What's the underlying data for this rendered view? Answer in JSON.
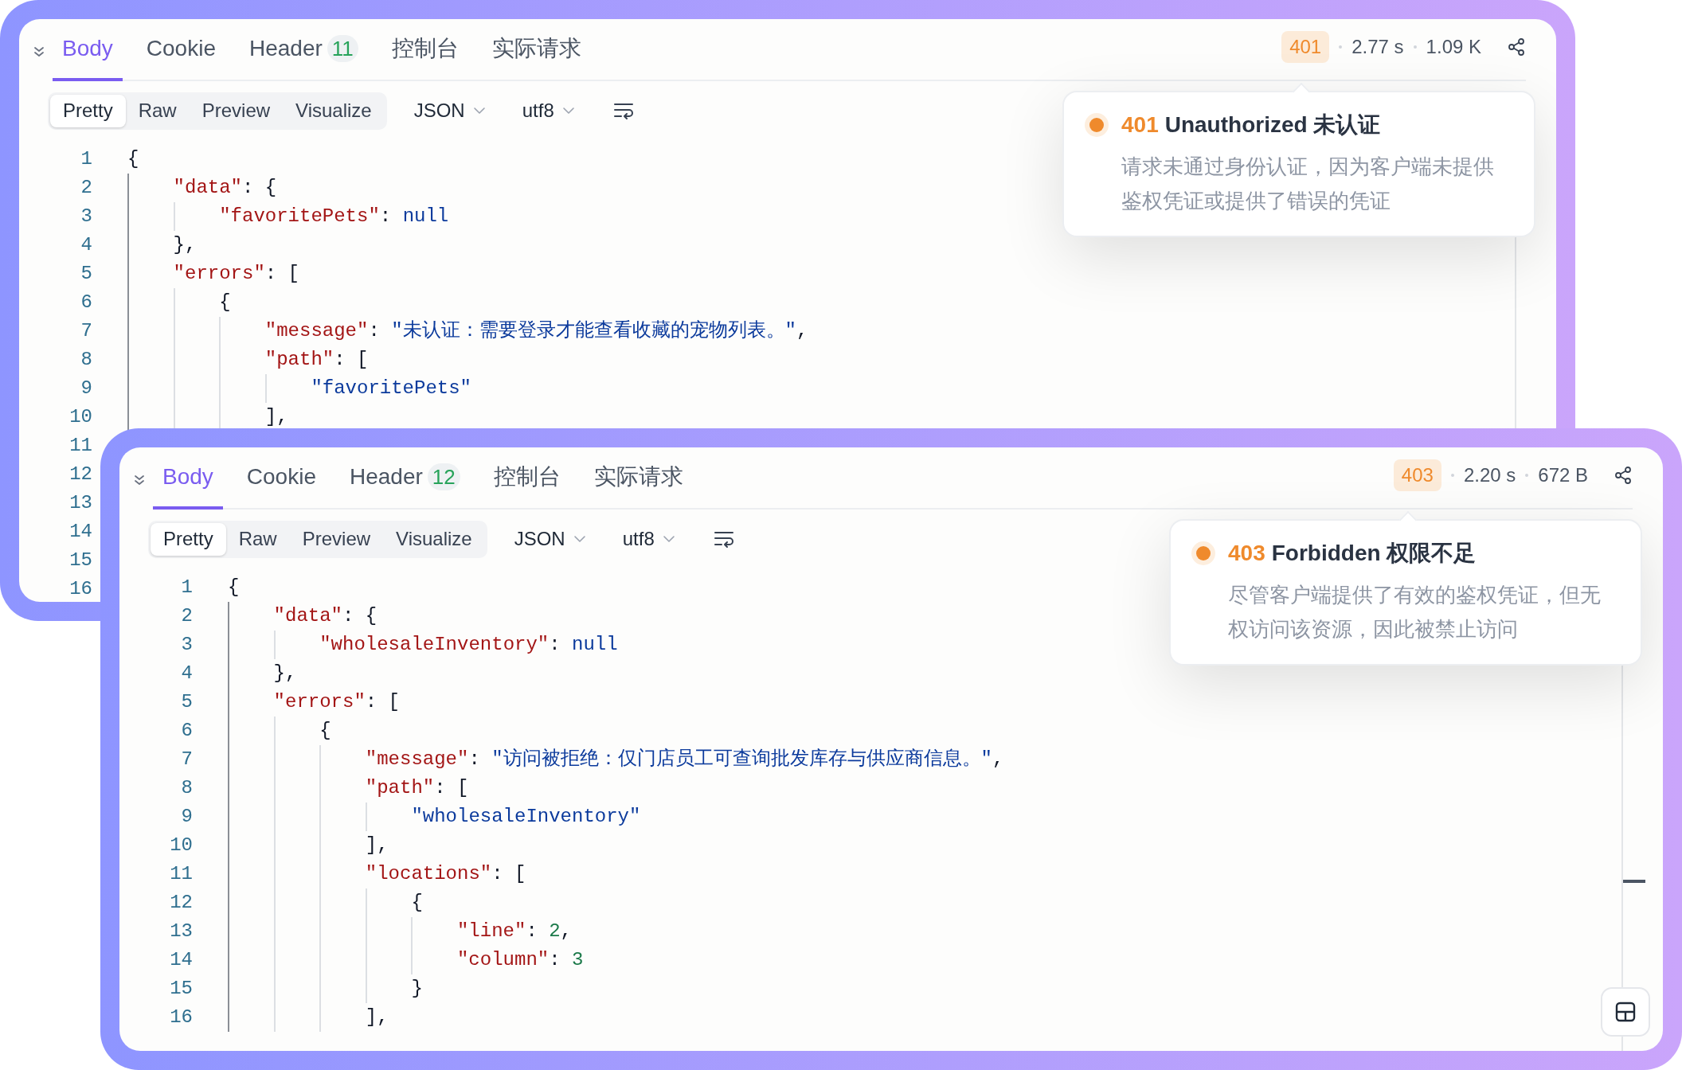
{
  "panels": [
    {
      "tabs": [
        {
          "label": "Body",
          "selected": true
        },
        {
          "label": "Cookie",
          "selected": false
        },
        {
          "label": "Header",
          "count": "11",
          "selected": false
        },
        {
          "label": "控制台",
          "selected": false
        },
        {
          "label": "实际请求",
          "selected": false
        }
      ],
      "status": {
        "code": "401",
        "time": "2.77 s",
        "size": "1.09 K"
      },
      "view_modes": [
        {
          "label": "Pretty",
          "selected": true
        },
        {
          "label": "Raw",
          "selected": false
        },
        {
          "label": "Preview",
          "selected": false
        },
        {
          "label": "Visualize",
          "selected": false
        }
      ],
      "format": "JSON",
      "encoding": "utf8",
      "lines": [
        {
          "num": "1",
          "tokens": [
            {
              "kind": "punct",
              "text": "{"
            }
          ],
          "children": [
            {
              "num": "2",
              "tokens": [
                {
                  "kind": "key",
                  "text": "\"data\""
                },
                {
                  "kind": "punct",
                  "text": ": {"
                }
              ],
              "children": [
                {
                  "num": "3",
                  "tokens": [
                    {
                      "kind": "key",
                      "text": "\"favoritePets\""
                    },
                    {
                      "kind": "punct",
                      "text": ": "
                    },
                    {
                      "kind": "literal",
                      "text": "null"
                    }
                  ]
                }
              ]
            },
            {
              "num": "4",
              "tokens": [
                {
                  "kind": "punct",
                  "text": "},"
                }
              ]
            },
            {
              "num": "5",
              "tokens": [
                {
                  "kind": "key",
                  "text": "\"errors\""
                },
                {
                  "kind": "punct",
                  "text": ": ["
                }
              ],
              "children": [
                {
                  "num": "6",
                  "tokens": [
                    {
                      "kind": "punct",
                      "text": "{"
                    }
                  ],
                  "children": [
                    {
                      "num": "7",
                      "tokens": [
                        {
                          "kind": "key",
                          "text": "\"message\""
                        },
                        {
                          "kind": "punct",
                          "text": ": "
                        },
                        {
                          "kind": "string",
                          "text": "\"未认证：需要登录才能查看收藏的宠物列表。\""
                        },
                        {
                          "kind": "punct",
                          "text": ","
                        }
                      ]
                    },
                    {
                      "num": "8",
                      "tokens": [
                        {
                          "kind": "key",
                          "text": "\"path\""
                        },
                        {
                          "kind": "punct",
                          "text": ": ["
                        }
                      ],
                      "children": [
                        {
                          "num": "9",
                          "tokens": [
                            {
                              "kind": "string",
                              "text": "\"favoritePets\""
                            }
                          ]
                        }
                      ]
                    },
                    {
                      "num": "10",
                      "tokens": [
                        {
                          "kind": "punct",
                          "text": "],"
                        }
                      ]
                    }
                  ]
                }
              ]
            }
          ]
        },
        {
          "num": "11"
        },
        {
          "num": "12"
        },
        {
          "num": "13"
        },
        {
          "num": "14"
        },
        {
          "num": "15"
        },
        {
          "num": "16"
        }
      ],
      "tooltip": {
        "code": "401",
        "title": "Unauthorized 未认证",
        "description": "请求未通过身份认证，因为客户端未提供鉴权凭证或提供了错误的凭证",
        "color": "#ef8a2c"
      }
    },
    {
      "tabs": [
        {
          "label": "Body",
          "selected": true
        },
        {
          "label": "Cookie",
          "selected": false
        },
        {
          "label": "Header",
          "count": "12",
          "selected": false
        },
        {
          "label": "控制台",
          "selected": false
        },
        {
          "label": "实际请求",
          "selected": false
        }
      ],
      "status": {
        "code": "403",
        "time": "2.20 s",
        "size": "672 B"
      },
      "view_modes": [
        {
          "label": "Pretty",
          "selected": true
        },
        {
          "label": "Raw",
          "selected": false
        },
        {
          "label": "Preview",
          "selected": false
        },
        {
          "label": "Visualize",
          "selected": false
        }
      ],
      "format": "JSON",
      "encoding": "utf8",
      "lines": [
        {
          "num": "1",
          "tokens": [
            {
              "kind": "punct",
              "text": "{"
            }
          ],
          "children": [
            {
              "num": "2",
              "tokens": [
                {
                  "kind": "key",
                  "text": "\"data\""
                },
                {
                  "kind": "punct",
                  "text": ": {"
                }
              ],
              "children": [
                {
                  "num": "3",
                  "tokens": [
                    {
                      "kind": "key",
                      "text": "\"wholesaleInventory\""
                    },
                    {
                      "kind": "punct",
                      "text": ": "
                    },
                    {
                      "kind": "literal",
                      "text": "null"
                    }
                  ]
                }
              ]
            },
            {
              "num": "4",
              "tokens": [
                {
                  "kind": "punct",
                  "text": "},"
                }
              ]
            },
            {
              "num": "5",
              "tokens": [
                {
                  "kind": "key",
                  "text": "\"errors\""
                },
                {
                  "kind": "punct",
                  "text": ": ["
                }
              ],
              "children": [
                {
                  "num": "6",
                  "tokens": [
                    {
                      "kind": "punct",
                      "text": "{"
                    }
                  ],
                  "children": [
                    {
                      "num": "7",
                      "tokens": [
                        {
                          "kind": "key",
                          "text": "\"message\""
                        },
                        {
                          "kind": "punct",
                          "text": ": "
                        },
                        {
                          "kind": "string",
                          "text": "\"访问被拒绝：仅门店员工可查询批发库存与供应商信息。\""
                        },
                        {
                          "kind": "punct",
                          "text": ","
                        }
                      ]
                    },
                    {
                      "num": "8",
                      "tokens": [
                        {
                          "kind": "key",
                          "text": "\"path\""
                        },
                        {
                          "kind": "punct",
                          "text": ": ["
                        }
                      ],
                      "children": [
                        {
                          "num": "9",
                          "tokens": [
                            {
                              "kind": "string",
                              "text": "\"wholesaleInventory\""
                            }
                          ]
                        }
                      ]
                    },
                    {
                      "num": "10",
                      "tokens": [
                        {
                          "kind": "punct",
                          "text": "],"
                        }
                      ]
                    },
                    {
                      "num": "11",
                      "tokens": [
                        {
                          "kind": "key",
                          "text": "\"locations\""
                        },
                        {
                          "kind": "punct",
                          "text": ": ["
                        }
                      ],
                      "children": [
                        {
                          "num": "12",
                          "tokens": [
                            {
                              "kind": "punct",
                              "text": "{"
                            }
                          ],
                          "children": [
                            {
                              "num": "13",
                              "tokens": [
                                {
                                  "kind": "key",
                                  "text": "\"line\""
                                },
                                {
                                  "kind": "punct",
                                  "text": ": "
                                },
                                {
                                  "kind": "number",
                                  "text": "2"
                                },
                                {
                                  "kind": "punct",
                                  "text": ","
                                }
                              ]
                            },
                            {
                              "num": "14",
                              "tokens": [
                                {
                                  "kind": "key",
                                  "text": "\"column\""
                                },
                                {
                                  "kind": "punct",
                                  "text": ": "
                                },
                                {
                                  "kind": "number",
                                  "text": "3"
                                }
                              ]
                            }
                          ]
                        },
                        {
                          "num": "15",
                          "tokens": [
                            {
                              "kind": "punct",
                              "text": "}"
                            }
                          ]
                        }
                      ]
                    },
                    {
                      "num": "16",
                      "tokens": [
                        {
                          "kind": "punct",
                          "text": "],"
                        }
                      ]
                    }
                  ]
                }
              ]
            }
          ]
        }
      ],
      "tooltip": {
        "code": "403",
        "title": "Forbidden 权限不足",
        "description": "尽管客户端提供了有效的鉴权凭证，但无权访问该资源，因此被禁止访问",
        "color": "#ef8a2c"
      }
    }
  ]
}
